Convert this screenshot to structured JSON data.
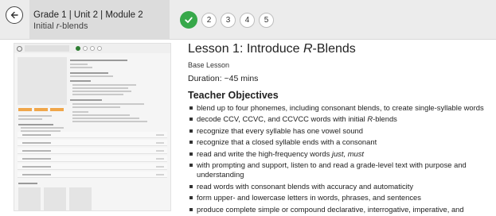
{
  "header": {
    "title": "Grade 1 | Unit 2 | Module 2",
    "subtitle": "Initial r-blends",
    "steps": [
      {
        "label": "",
        "completed": true
      },
      {
        "label": "2",
        "completed": false
      },
      {
        "label": "3",
        "completed": false
      },
      {
        "label": "4",
        "completed": false
      },
      {
        "label": "5",
        "completed": false
      }
    ],
    "colors": {
      "header_bg": "#ececec",
      "title_bg": "#dcdcdc",
      "step_completed": "#37a84a"
    }
  },
  "lesson": {
    "title_prefix": "Lesson 1: Introduce ",
    "title_italic": "R",
    "title_suffix": "-Blends",
    "type": "Base Lesson",
    "duration": "Duration: ~45 mins",
    "objectives_heading": "Teacher Objectives",
    "objectives": [
      [
        {
          "t": "blend up to four phonemes, including consonant blends, to create single-syllable words"
        }
      ],
      [
        {
          "t": "decode CCV, CCVC, and CCVCC words with initial "
        },
        {
          "t": "R",
          "i": true
        },
        {
          "t": "-blends"
        }
      ],
      [
        {
          "t": "recognize that every syllable has one vowel sound"
        }
      ],
      [
        {
          "t": "recognize that a closed syllable ends with a consonant"
        }
      ],
      [
        {
          "t": "read and write the high-frequency words "
        },
        {
          "t": "just, must",
          "i": true
        }
      ],
      [
        {
          "t": "with prompting and support, listen to and read a grade-level text with purpose and understanding"
        }
      ],
      [
        {
          "t": "read words with consonant blends with accuracy and automaticity"
        }
      ],
      [
        {
          "t": "form upper- and lowercase letters in words, phrases, and sentences"
        }
      ],
      [
        {
          "t": "produce complete simple or compound declarative, interrogative, imperative, and exclamatory sentences in response to a prompt"
        }
      ]
    ]
  }
}
